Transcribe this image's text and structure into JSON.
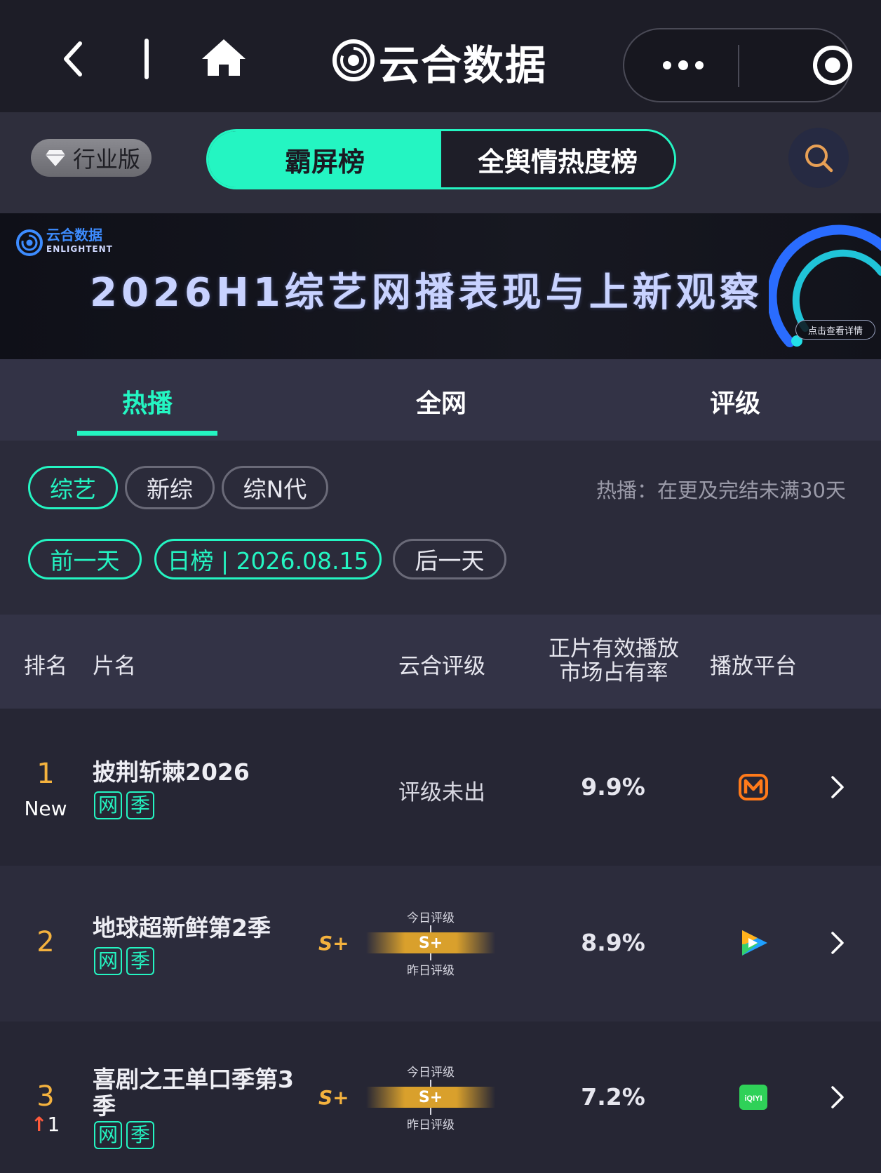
{
  "titlebar": {
    "title": "云合数据",
    "icons": [
      "back-icon",
      "home-icon",
      "more-icon",
      "target-icon"
    ]
  },
  "toolbar": {
    "industry_label": "行业版",
    "segments": [
      {
        "label": "霸屏榜",
        "active": true
      },
      {
        "label": "全舆情热度榜",
        "active": false
      }
    ]
  },
  "banner": {
    "brand_cn": "云合数据",
    "brand_en": "ENLIGHTENT",
    "title": "2026H1综艺网播表现与上新观察",
    "cta": "点击查看详情"
  },
  "tabs": [
    {
      "label": "热播",
      "active": true
    },
    {
      "label": "全网",
      "active": false
    },
    {
      "label": "评级",
      "active": false
    }
  ],
  "filters": {
    "categories": [
      {
        "label": "综艺",
        "active": true
      },
      {
        "label": "新综",
        "active": false
      },
      {
        "label": "综N代",
        "active": false
      }
    ],
    "hint": "热播：在更及完结未满30天",
    "date_nav": {
      "prev": "前一天",
      "current": "日榜 | 2026.08.15",
      "next": "后一天"
    }
  },
  "table": {
    "headers": {
      "rank": "排名",
      "name": "片名",
      "rating": "云合评级",
      "share_line1": "正片有效播放",
      "share_line2": "市场占有率",
      "platform": "播放平台"
    },
    "rows": [
      {
        "rank": "1",
        "change": "New",
        "name": "披荆斩棘2026",
        "tags": [
          "网",
          "季"
        ],
        "rating_text": "评级未出",
        "share": "9.9%",
        "platform": "mango-tv-icon"
      },
      {
        "rank": "2",
        "change": "",
        "name": "地球超新鲜第2季",
        "tags": [
          "网",
          "季"
        ],
        "rating_side": "S+",
        "today_label": "今日评级",
        "rating_today": "S+",
        "yesterday_label": "昨日评级",
        "share": "8.9%",
        "platform": "tencent-video-icon"
      },
      {
        "rank": "3",
        "change": "1",
        "name": "喜剧之王单口季第3季",
        "tags": [
          "网",
          "季"
        ],
        "rating_side": "S+",
        "today_label": "今日评级",
        "rating_today": "S+",
        "yesterday_label": "昨日评级",
        "share": "7.2%",
        "platform": "iqiyi-icon",
        "platform_text": "iQIYI"
      }
    ]
  },
  "colors": {
    "accent": "#24f5c2",
    "rank": "#f4b23e",
    "rank_up_arrow": "#ff5a3c",
    "mango": "#ff7a1a",
    "iqiyi": "#2fd158"
  }
}
